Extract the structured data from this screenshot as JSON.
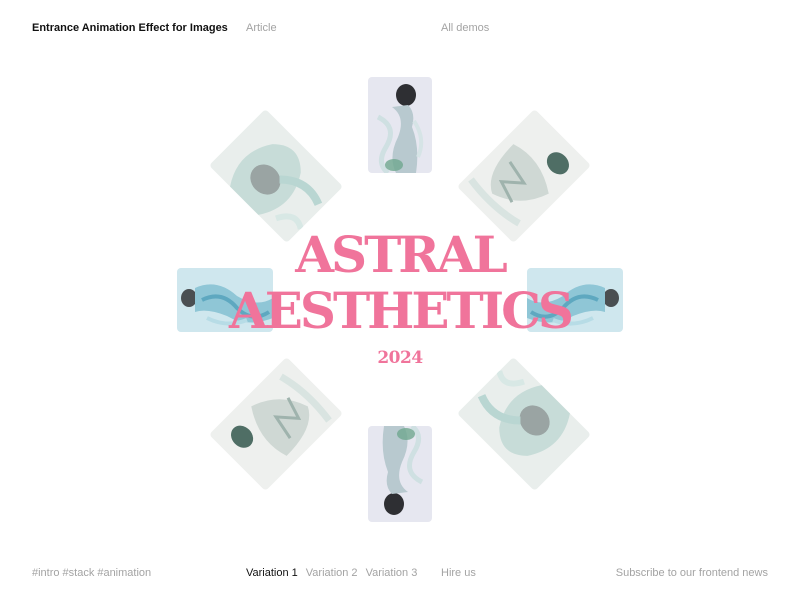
{
  "header": {
    "site_title": "Entrance Animation Effect for Images",
    "nav_article": "Article",
    "nav_all_demos": "All demos"
  },
  "hero": {
    "title_line_1": "ASTRAL",
    "title_line_2": "AESTHETICS",
    "year": "2024"
  },
  "footer": {
    "tags": [
      "#intro",
      "#stack",
      "#animation"
    ],
    "variations": [
      {
        "label": "Variation 1",
        "active": true
      },
      {
        "label": "Variation 2",
        "active": false
      },
      {
        "label": "Variation 3",
        "active": false
      }
    ],
    "hire": "Hire us",
    "subscribe": "Subscribe to our frontend news"
  },
  "colors": {
    "accent": "#f0749b",
    "muted_text": "#a3a3a3",
    "primary_text": "#111111",
    "background": "#ffffff"
  }
}
